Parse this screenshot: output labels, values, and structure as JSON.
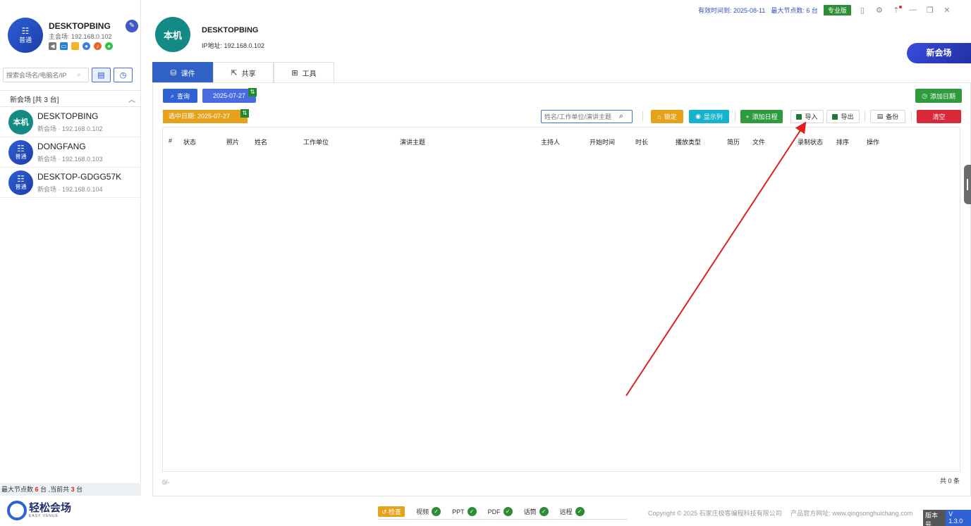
{
  "self": {
    "avatar_label": "普通",
    "name": "DESKTOPBING",
    "sub": "主会场: 192.168.0.102"
  },
  "sidebar": {
    "search_placeholder": "搜索会场名/电脑名/IP",
    "group_label": "新会场  [共 3 台]",
    "nodes": [
      {
        "avatar": "本机",
        "name": "DESKTOPBING",
        "ip": "新会场 · 192.168.0.102",
        "color": "#138a84"
      },
      {
        "avatar": "普通",
        "name": "DONGFANG",
        "ip": "新会场 · 192.168.0.103",
        "color": "#2d5fd6"
      },
      {
        "avatar": "普通",
        "name": "DESKTOP-GDGG57K",
        "ip": "新会场 · 192.168.0.104",
        "color": "#2d5fd6"
      }
    ],
    "footer_prefix": "最大节点数",
    "footer_max": "6",
    "footer_mid": "台 ,当前共",
    "footer_cur": "3",
    "footer_suffix": "台"
  },
  "topbar": {
    "expiry": "有效时间到: 2025-08-11",
    "max_nodes": "最大节点数: 6 台",
    "edition": "专业版"
  },
  "host": {
    "avatar": "本机",
    "name": "DESKTOPBING",
    "ip": "IP地址: 192.168.0.102"
  },
  "new_venue_label": "新会场",
  "tabs": [
    {
      "label": "课件",
      "icon": "courseware-icon"
    },
    {
      "label": "共享",
      "icon": "share-icon"
    },
    {
      "label": "工具",
      "icon": "tools-icon"
    }
  ],
  "toolbar": {
    "query": "查询",
    "date": "2025-07-27",
    "add_date": "添加日期",
    "selected_date": "选中日期:  2025-07-27",
    "keyword_placeholder": "姓名/工作单位/演讲主题",
    "lock": "锁定",
    "show_columns": "显示列",
    "add_schedule": "添加日程",
    "import": "导入",
    "export": "导出",
    "backup": "备份",
    "clear": "清空"
  },
  "table": {
    "columns": [
      "#",
      "状态",
      "照片",
      "姓名",
      "工作单位",
      "演讲主题",
      "主持人",
      "开始时间",
      "时长",
      "播放类型",
      "简历",
      "文件",
      "录制状态",
      "排序",
      "操作"
    ],
    "rows": [],
    "footer_hint": "0/-",
    "count": "共 0 条"
  },
  "footer": {
    "logo_text": "轻松会场",
    "logo_sub": "EASY VENUE",
    "check_btn": "检查",
    "checks": [
      "视频",
      "PPT",
      "PDF",
      "话筒",
      "远程"
    ],
    "copyright": "Copyright © 2025 石家庄极客编程科技有限公司",
    "website": "产品官方网址: www.qingsonghuichang.com",
    "version_key": "版本号",
    "version_val": "V 1.3.0"
  },
  "colors": {
    "primary": "#2f62c4",
    "success": "#2e9b3d",
    "warning": "#e6a21b",
    "info": "#17b3cc",
    "danger": "#d8283a",
    "annotation_arrow": "#e02020"
  }
}
